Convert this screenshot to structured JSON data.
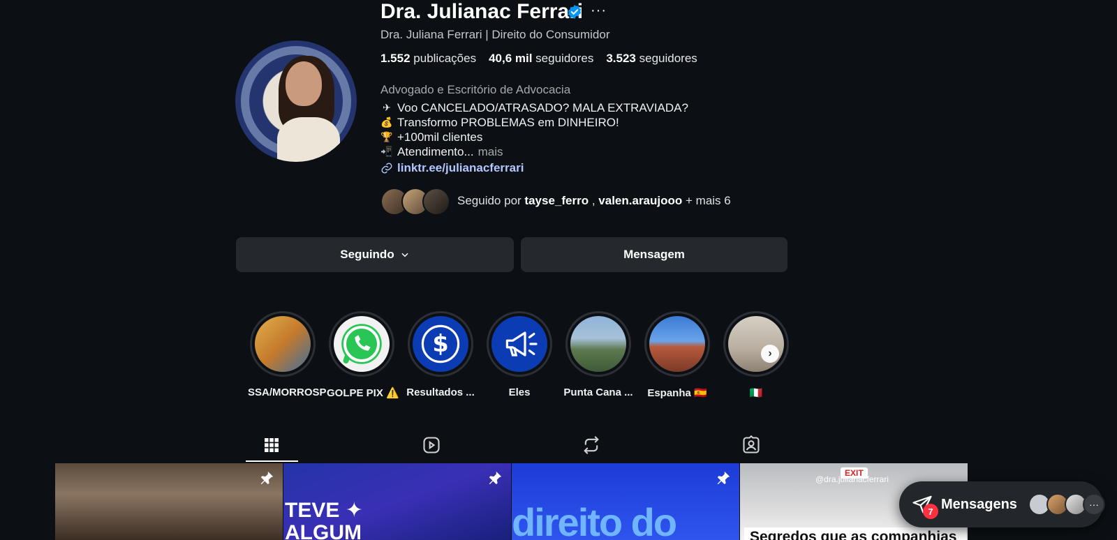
{
  "profile": {
    "username": "Dra. Julianac Ferrari",
    "full_name": "Dra. Juliana Ferrari | Direito do Consumidor",
    "stats": {
      "posts_count": "1.552",
      "posts_label": "publicações",
      "followers_count": "40,6 mil",
      "followers_label": "seguidores",
      "following_count": "3.523",
      "following_label": "seguidores"
    },
    "category": "Advogado e Escritório de Advocacia",
    "bio": [
      {
        "icon": "✈",
        "text": "Voo CANCELADO/ATRASADO? MALA EXTRAVIADA?"
      },
      {
        "icon": "💰",
        "text": "Transformo PROBLEMAS em DINHEIRO!"
      },
      {
        "icon": "🏆",
        "text": "+100mil clientes"
      },
      {
        "icon": "📲",
        "text": "Atendimento..."
      }
    ],
    "bio_more": "mais",
    "link": "linktr.ee/julianacferrari",
    "followed_by": {
      "prefix": "Seguido por",
      "user1": "tayse_ferro",
      "separator": ",",
      "user2": "valen.araujooo",
      "suffix": "+ mais 6"
    }
  },
  "buttons": {
    "following": "Seguindo",
    "message": "Mensagem"
  },
  "highlights": [
    {
      "label": "SSA/MORROSP"
    },
    {
      "label": "GOLPE PIX ⚠️"
    },
    {
      "label": "Resultados ..."
    },
    {
      "label": "Eles"
    },
    {
      "label": "Punta Cana ..."
    },
    {
      "label": "Espanha 🇪🇸"
    },
    {
      "label": "🇮🇹"
    }
  ],
  "tabs": [
    "posts-tab",
    "reels-tab",
    "reposts-tab",
    "tagged-tab"
  ],
  "posts": {
    "p2_title": "TEVE ✦\nALGUM",
    "p3_title": "direito do",
    "p4_handle": "@dra.julianacferrari",
    "p4_exit": "EXIT",
    "p4_caption": "Segredos que as companhias"
  },
  "messages": {
    "label": "Mensagens",
    "badge": "7"
  },
  "colors": {
    "background": "#0c1014",
    "button": "#25292e",
    "link": "#b3c7ff",
    "verified": "#0095f6",
    "badge": "#ff3040"
  }
}
